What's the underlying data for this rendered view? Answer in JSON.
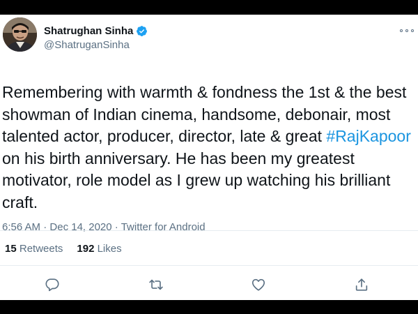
{
  "tweet": {
    "author": {
      "display_name": "Shatrughan Sinha",
      "handle": "@ShatruganSinha",
      "verified": true,
      "avatar_icon": "profile-photo"
    },
    "text_before_hashtag": "Remembering with warmth & fondness the 1st & the best showman of Indian cinema, handsome, debonair, most talented actor, producer, director, late & great",
    "hashtag": "#RajKapoor",
    "text_after_hashtag": "on his birth anniversary. He has been my greatest motivator, role model as I grew up watching his brilliant craft.",
    "time": "6:56 AM",
    "date": "Dec 14, 2020",
    "source": "Twitter for Android",
    "meta_separator": "·",
    "retweets_count": "15",
    "retweets_label": "Retweets",
    "likes_count": "192",
    "likes_label": "Likes"
  },
  "actions": [
    "reply-icon",
    "retweet-icon",
    "like-icon",
    "share-icon"
  ],
  "colors": {
    "text": "#0f1419",
    "secondary": "#5b7083",
    "link": "#1b95e0",
    "verified": "#1da1f2",
    "divider": "#e6ecf0",
    "frame": "#000000"
  }
}
